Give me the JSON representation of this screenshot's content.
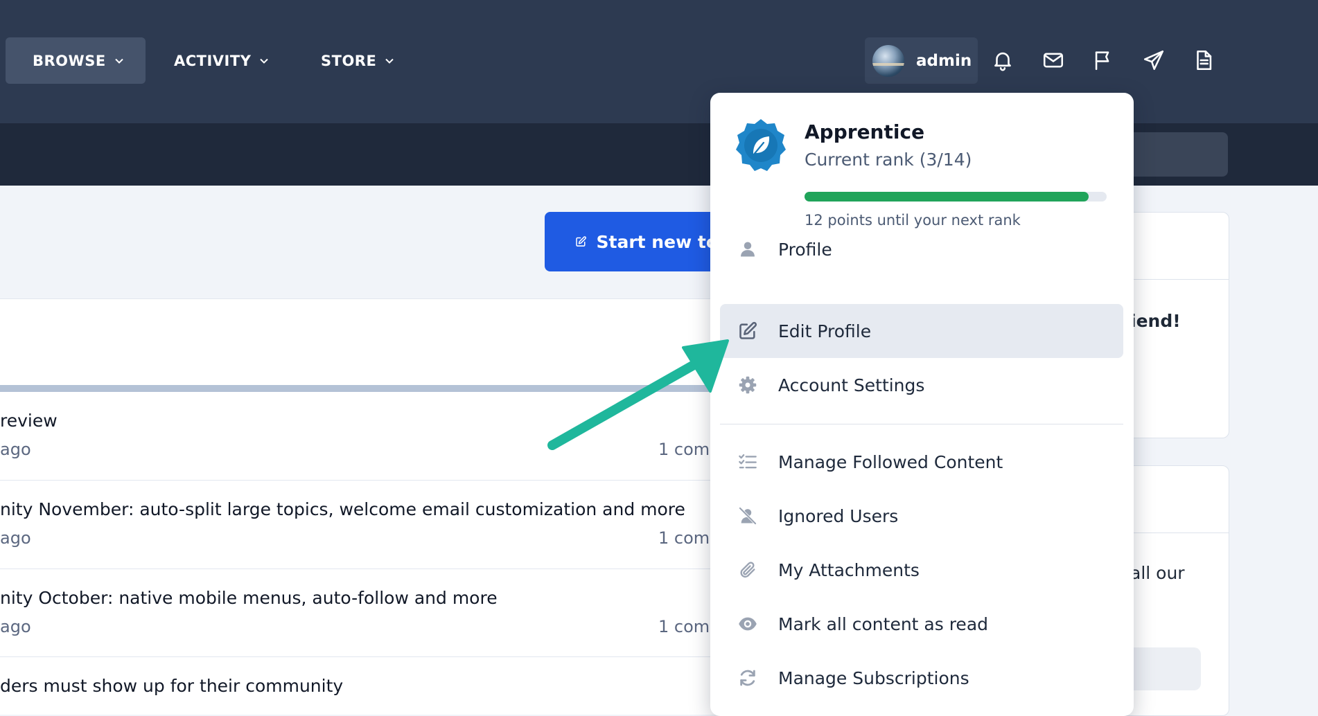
{
  "nav": {
    "items": [
      {
        "label": "BROWSE",
        "active": true
      },
      {
        "label": "ACTIVITY",
        "active": false
      },
      {
        "label": "STORE",
        "active": false
      }
    ]
  },
  "user": {
    "name": "admin"
  },
  "header_icons": [
    "bell-icon",
    "envelope-icon",
    "flag-icon",
    "paper-plane-icon",
    "document-icon"
  ],
  "main": {
    "start_button": "Start new to",
    "topics": [
      {
        "title": "review",
        "meta": "ago",
        "comments": "1 comm"
      },
      {
        "title": "nity November: auto-split large topics, welcome email customization and more",
        "meta": "ago",
        "comments": "1 comm"
      },
      {
        "title": "nity October: native mobile menus, auto-follow and more",
        "meta": "ago",
        "comments": "1 comm"
      },
      {
        "title": "ders must show up for their community",
        "meta": "",
        "comments": ""
      }
    ],
    "side": {
      "card1_text": "iend!",
      "card2_text": "all our"
    }
  },
  "dropdown": {
    "rank": {
      "title": "Apprentice",
      "subtitle": "Current rank (3/14)",
      "progress": 0.94,
      "points_text": "12 points until your next rank"
    },
    "items": [
      {
        "label": "Profile",
        "icon": "user-icon",
        "highlighted": false
      },
      {
        "label": "Edit Profile",
        "icon": "edit-icon",
        "highlighted": true
      },
      {
        "label": "Account Settings",
        "icon": "gear-icon",
        "highlighted": false
      },
      {
        "label": "Manage Followed Content",
        "icon": "checklist-icon",
        "highlighted": false
      },
      {
        "label": "Ignored Users",
        "icon": "user-slash-icon",
        "highlighted": false
      },
      {
        "label": "My Attachments",
        "icon": "paperclip-icon",
        "highlighted": false
      },
      {
        "label": "Mark all content as read",
        "icon": "eye-icon",
        "highlighted": false
      },
      {
        "label": "Manage Subscriptions",
        "icon": "refresh-icon",
        "highlighted": false
      }
    ]
  },
  "colors": {
    "header_bg": "#2d3a51",
    "subbar_bg": "#1f293b",
    "primary_button": "#1f5be3",
    "progress_fill": "#20a45a",
    "annotation_arrow": "#1fb79c",
    "menu_highlight": "#e6eaf1"
  }
}
